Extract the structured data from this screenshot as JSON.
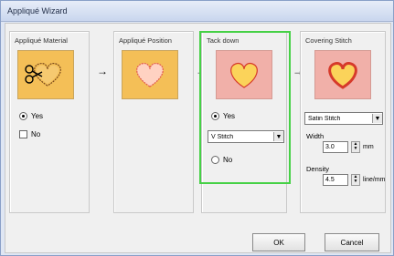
{
  "window": {
    "title": "Appliqué Wizard"
  },
  "panels": {
    "applique_material": {
      "label": "Appliqué Material",
      "yes": "Yes",
      "no": "No"
    },
    "applique_position": {
      "label": "Appliqué Position"
    },
    "tack_down": {
      "label": "Tack down",
      "yes": "Yes",
      "select_value": "V Stitch",
      "no": "No"
    },
    "covering_stitch": {
      "label": "Covering Stitch",
      "select_value": "Satin Stitch",
      "width_label": "Width",
      "width_value": "3.0",
      "width_unit": "mm",
      "density_label": "Density",
      "density_value": "4.5",
      "density_unit": "line/mm"
    }
  },
  "buttons": {
    "ok": "OK",
    "cancel": "Cancel"
  },
  "arrows": [
    "→",
    "→",
    "→"
  ],
  "colors": {
    "highlight": "#46d146",
    "orange_tile": "#f4bf57",
    "pink_tile": "#f1b0a9",
    "heart_red": "#d63a2a"
  }
}
